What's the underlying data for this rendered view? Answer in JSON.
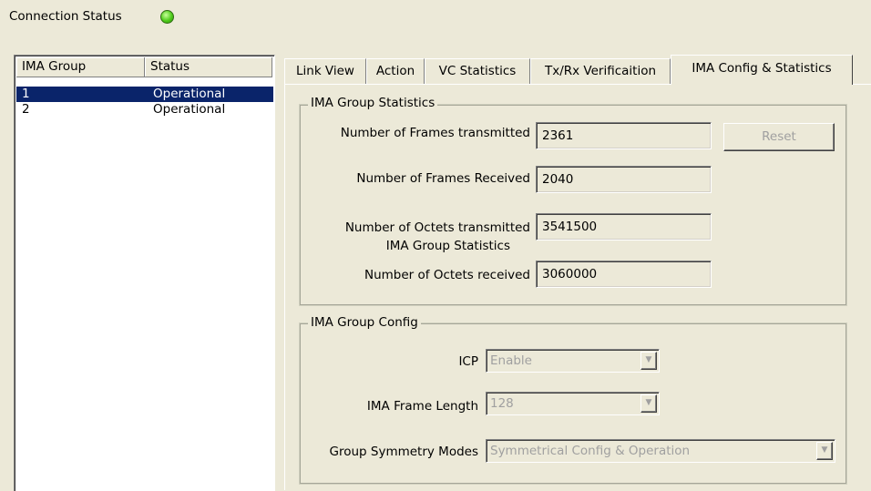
{
  "connection": {
    "label": "Connection Status",
    "state_color": "#3fc41a"
  },
  "group_list": {
    "headers": [
      "IMA Group",
      "Status"
    ],
    "rows": [
      {
        "group": "1",
        "status": "Operational",
        "selected": true
      },
      {
        "group": "2",
        "status": "Operational",
        "selected": false
      }
    ]
  },
  "tabs": [
    {
      "label": "Link View",
      "active": false
    },
    {
      "label": "Action",
      "active": false
    },
    {
      "label": "VC Statistics",
      "active": false
    },
    {
      "label": "Tx/Rx Verificaition",
      "active": false
    },
    {
      "label": "IMA Config & Statistics",
      "active": true
    }
  ],
  "statistics": {
    "title": "IMA Group Statistics",
    "frames_tx_label": "Number of Frames transmitted",
    "frames_tx_value": "2361",
    "frames_rx_label": "Number of Frames Received",
    "frames_rx_value": "2040",
    "octets_tx_label": "Number of Octets transmitted",
    "octets_tx_sub": "IMA Group Statistics",
    "octets_tx_value": "3541500",
    "octets_rx_label": "Number of Octets received",
    "octets_rx_value": "3060000",
    "reset_label": "Reset"
  },
  "config": {
    "title": "IMA Group Config",
    "icp_label": "ICP",
    "icp_value": "Enable",
    "frame_length_label": "IMA Frame Length",
    "frame_length_value": "128",
    "symmetry_label": "Group Symmetry Modes",
    "symmetry_value": "Symmetrical Config & Operation"
  },
  "icons": {
    "dropdown_arrow": "▼"
  }
}
